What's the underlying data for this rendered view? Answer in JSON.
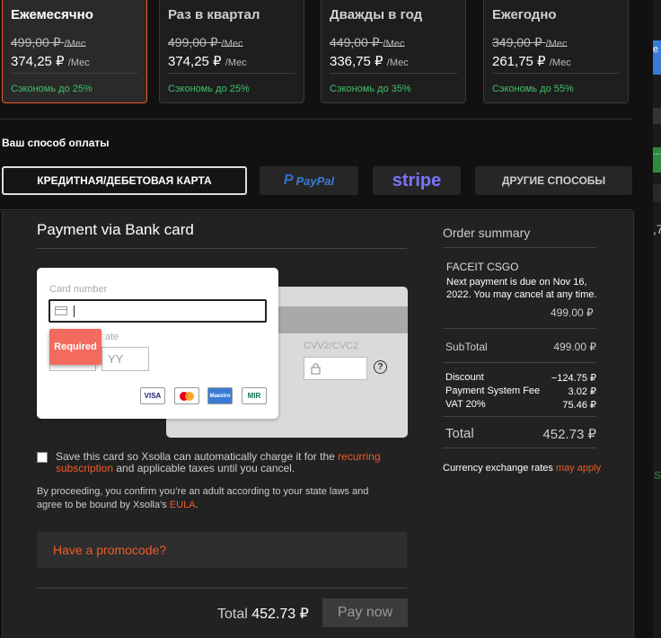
{
  "plans": [
    {
      "name": "Ежемесячно",
      "old_price": "499,00 ₽",
      "new_price": "374,25 ₽",
      "unit": "/Мес",
      "save": "Сэкономь до 25%"
    },
    {
      "name": "Раз в квартал",
      "old_price": "499,00 ₽",
      "new_price": "374,25 ₽",
      "unit": "/Мес",
      "save": "Сэкономь до 25%"
    },
    {
      "name": "Дважды в год",
      "old_price": "449,00 ₽",
      "new_price": "336,75 ₽",
      "unit": "/Мес",
      "save": "Сэкономь до 35%"
    },
    {
      "name": "Ежегодно",
      "old_price": "349,00 ₽",
      "new_price": "261,75 ₽",
      "unit": "/Мес",
      "save": "Сэкономь до 55%"
    }
  ],
  "payment_methods": {
    "title": "Ваш способ оплаты",
    "card": "КРЕДИТНАЯ/ДЕБЕТОВАЯ КАРТА",
    "paypal_p": "P",
    "paypal": "PayPal",
    "stripe": "stripe",
    "other": "ДРУГИЕ СПОСОБЫ"
  },
  "form": {
    "title": "Payment via Bank card",
    "card_number_label": "Card number",
    "expiry_label": "ate",
    "expiry_placeholder": "YY",
    "required": "Required",
    "cvv_label": "CVV2/CVC2",
    "brands": [
      "VISA",
      "Maestro",
      "MIR"
    ],
    "save_text_1": "Save this card so Xsolla can automatically charge it for the ",
    "save_link": "recurring subscription",
    "save_text_2": " and applicable taxes until you cancel.",
    "consent_1": "By proceeding, you confirm you’re an adult according to your state laws and agree to be bound by Xsolla’s ",
    "consent_link": "EULA",
    "consent_end": ".",
    "promo": "Have a promocode?",
    "total_label": "Total",
    "total_value": "452.73 ₽",
    "pay_now": "Pay now"
  },
  "summary": {
    "title": "Order summary",
    "product": "FACEIT CSGO",
    "note": "Next payment is due on Nov 16, 2022. You may cancel at any time.",
    "product_price": "499.00 ₽",
    "subtotal_label": "SubTotal",
    "subtotal": "499.00 ₽",
    "discount_label": "Discount",
    "discount": "−124.75 ₽",
    "fee_label": "Payment System Fee",
    "fee": "3.02 ₽",
    "vat_label": "VAT 20%",
    "vat": "75.46 ₽",
    "total_label": "Total",
    "total": "452.73 ₽",
    "fx_text": "Currency exchange rates ",
    "fx_link": "may apply"
  },
  "peek": {
    "e": "e",
    "ellipsis": "...",
    "seven": ",7",
    "s": "S"
  },
  "colors": {
    "accent": "#f05a28",
    "save_green": "#3fc06a",
    "error": "#f26b5e"
  }
}
